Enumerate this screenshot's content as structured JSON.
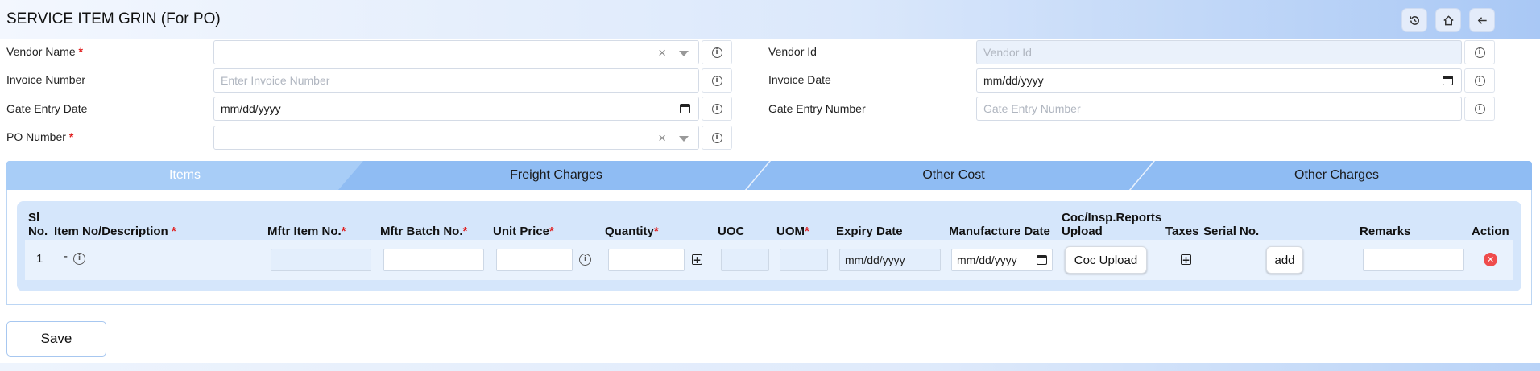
{
  "header": {
    "title": "SERVICE ITEM GRIN (For PO)",
    "icons": [
      "history-icon",
      "home-icon",
      "back-arrow-icon"
    ]
  },
  "form": {
    "vendor_name": {
      "label": "Vendor Name",
      "required": "*",
      "value": ""
    },
    "vendor_id": {
      "label": "Vendor Id",
      "placeholder": "Vendor Id"
    },
    "invoice_number": {
      "label": "Invoice Number",
      "placeholder": "Enter Invoice Number"
    },
    "invoice_date": {
      "label": "Invoice Date",
      "value": "mm/dd/yyyy"
    },
    "gate_entry_date": {
      "label": "Gate Entry Date",
      "value": "mm/dd/yyyy"
    },
    "gate_entry_number": {
      "label": "Gate Entry Number",
      "placeholder": "Gate Entry Number"
    },
    "po_number": {
      "label": "PO Number",
      "required": "*",
      "value": ""
    }
  },
  "tabs": [
    {
      "label": "Items",
      "active": true
    },
    {
      "label": "Freight Charges",
      "active": false
    },
    {
      "label": "Other Cost",
      "active": false
    },
    {
      "label": "Other Charges",
      "active": false
    }
  ],
  "table": {
    "headers": {
      "sl_no_1": "Sl",
      "sl_no_2": "No.",
      "item": "Item No/Description",
      "mftr_item": "Mftr Item No.",
      "mftr_batch": "Mftr Batch No.",
      "unit_price": "Unit Price",
      "quantity": "Quantity",
      "uoc": "UOC",
      "uom": "UOM",
      "expiry_date": "Expiry Date",
      "manufacture_date": "Manufacture Date",
      "coc_1": "Coc/Insp.Reports",
      "coc_2": "Upload",
      "taxes": "Taxes",
      "serial_no": "Serial No.",
      "remarks": "Remarks",
      "action": "Action",
      "required_mark": "*"
    },
    "rows": [
      {
        "sl_no": "1",
        "item": "-",
        "expiry_date": "mm/dd/yyyy",
        "manufacture_date": "mm/dd/yyyy",
        "coc_button": "Coc Upload",
        "serial_button": "add"
      }
    ]
  },
  "footer": {
    "save_label": "Save"
  }
}
